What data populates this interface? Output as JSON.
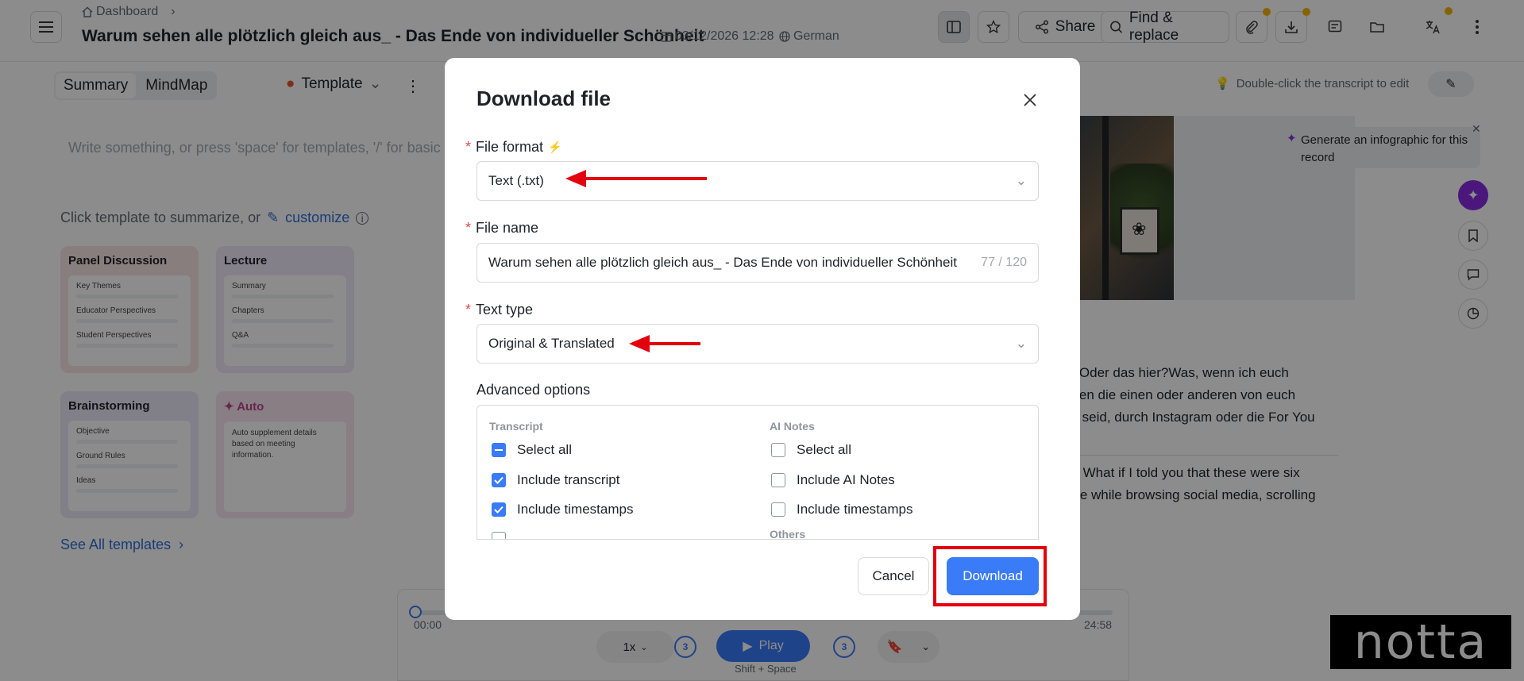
{
  "header": {
    "breadcrumb": "Dashboard",
    "title": "Warum sehen alle plötzlich gleich aus_ - Das Ende von individueller Schönheit",
    "datetime": "03/12/2026 12:28",
    "language": "German",
    "share_label": "Share",
    "find_replace_label": "Find & replace"
  },
  "left": {
    "tabs": [
      "Summary",
      "MindMap"
    ],
    "template_label": "Template",
    "placeholder": "Write something, or press 'space' for templates, '/' for basic ...",
    "summarize_hint": "Click template to summarize, or",
    "customize_label": "customize",
    "cards": [
      {
        "title": "Panel Discussion",
        "lines": [
          "Key Themes",
          "Educator Perspectives",
          "Student Perspectives"
        ],
        "color": "#f9e5e6"
      },
      {
        "title": "Lecture",
        "lines": [
          "Summary",
          "Chapters",
          "Q&A"
        ],
        "color": "#efe9f9"
      },
      {
        "title": "Brainstorming",
        "lines": [
          "Objective",
          "Ground Rules",
          "Ideas"
        ],
        "color": "#ebe7f7"
      },
      {
        "title": "Auto",
        "lines": [
          "Auto supplement details based on meeting information."
        ],
        "color": "#f8e6ef"
      }
    ],
    "see_all_label": "See All templates"
  },
  "right": {
    "edit_hint": "Double-click the transcript to edit",
    "infographic_hint": "Generate an infographic for this record",
    "transcript_lines": [
      "d?Oder das hier?Was, wenn ich euch",
      "atten die einen oder anderen von euch",
      "gs seid, durch Instagram oder die For You",
      "e? What if I told you that these were six",
      "fore while browsing social media, scrolling"
    ]
  },
  "player": {
    "current_time": "00:00",
    "duration": "24:58",
    "speed": "1x",
    "skip_back": "3",
    "skip_forward": "3",
    "play_label": "Play",
    "hotkey": "Shift + Space",
    "progress": 0
  },
  "watermark": "notta",
  "modal": {
    "title": "Download file",
    "file_format_label": "File format",
    "file_format_value": "Text (.txt)",
    "file_name_label": "File name",
    "file_name_value": "Warum sehen alle plötzlich gleich aus_ - Das Ende von individueller Schönheit",
    "file_name_count": "77 / 120",
    "text_type_label": "Text type",
    "text_type_value": "Original & Translated",
    "advanced_label": "Advanced options",
    "transcript_head": "Transcript",
    "ai_notes_head": "AI Notes",
    "others_head": "Others",
    "transcript_options": [
      {
        "label": "Select all",
        "state": "mixed"
      },
      {
        "label": "Include transcript",
        "state": "checked"
      },
      {
        "label": "Include timestamps",
        "state": "checked"
      }
    ],
    "ai_options": [
      {
        "label": "Select all",
        "state": "unchecked"
      },
      {
        "label": "Include AI Notes",
        "state": "unchecked"
      },
      {
        "label": "Include timestamps",
        "state": "unchecked"
      }
    ],
    "cancel_label": "Cancel",
    "download_label": "Download"
  },
  "colors": {
    "accent": "#3a7bf7",
    "highlight": "#e3000f",
    "required": "#e5484d"
  }
}
